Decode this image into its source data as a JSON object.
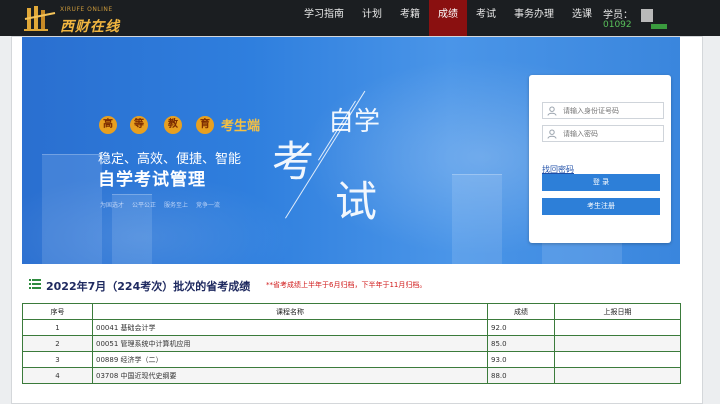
{
  "header": {
    "logo_text": "西财在线",
    "logo_subtext": "XIRUFE ONLINE",
    "nav": [
      {
        "label": "学习指南",
        "active": false
      },
      {
        "label": "计划",
        "active": false
      },
      {
        "label": "考籍",
        "active": false
      },
      {
        "label": "成绩",
        "active": true
      },
      {
        "label": "考试",
        "active": false
      },
      {
        "label": "事务办理",
        "active": false
      },
      {
        "label": "选课",
        "active": false
      }
    ],
    "student_label": "学员：",
    "student_id": "01092"
  },
  "banner": {
    "seal_chars": [
      "高",
      "等",
      "教",
      "育"
    ],
    "tag_end": "考生端",
    "slogan": "稳定、高效、便捷、智能",
    "headline": "自学考试管理",
    "keywords": [
      "为国选才",
      "公平公正",
      "服务至上",
      "竞争一流"
    ],
    "art": {
      "c1": "自学",
      "c2": "考",
      "c3": "试"
    }
  },
  "login": {
    "id_placeholder": "请输入身份证号码",
    "pwd_placeholder": "请输入密码",
    "forgot": "找回密码",
    "login_button": "登 录",
    "register_button": "考生注册"
  },
  "results": {
    "title": "2022年7月（224考次）批次的省考成绩",
    "note": "**省考成绩上半年于6月归档，下半年于11月归档。",
    "columns": [
      "序号",
      "课程名称",
      "成绩",
      "上报日期"
    ],
    "rows": [
      {
        "no": "1",
        "course": "00041 基础会计学",
        "score": "92.0",
        "date": ""
      },
      {
        "no": "2",
        "course": "00051 管理系统中计算机应用",
        "score": "85.0",
        "date": ""
      },
      {
        "no": "3",
        "course": "00889 经济学（二）",
        "score": "93.0",
        "date": ""
      },
      {
        "no": "4",
        "course": "03708 中国近现代史纲要",
        "score": "88.0",
        "date": ""
      }
    ]
  },
  "colors": {
    "topbar": "#1b1e21",
    "nav_active": "#8a1010",
    "banner_blue": "#2f7fde",
    "button_blue": "#2d7fd8",
    "note_red": "#d01818",
    "table_border": "#3b7b3b",
    "title_navy": "#1f2a60"
  },
  "icons": {
    "logo": "stylized-columns-logo-icon",
    "input_user": "user-icon",
    "results_heading": "list-icon"
  }
}
